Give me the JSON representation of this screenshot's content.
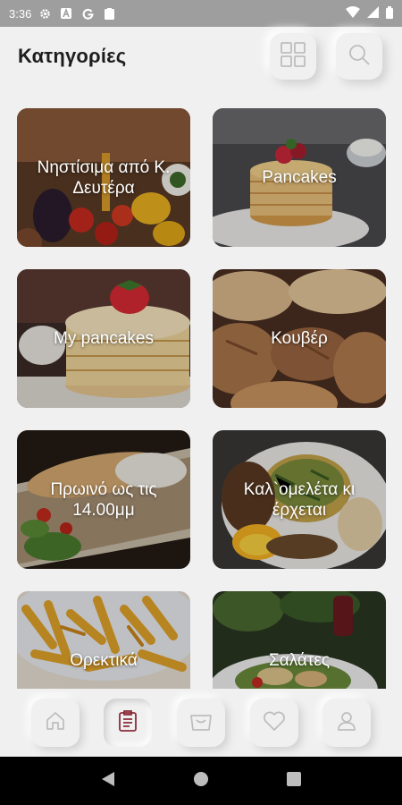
{
  "status_bar": {
    "time": "3:36",
    "left_icons": [
      "gear-icon",
      "a-badge-icon",
      "g-icon",
      "clipboard-icon"
    ],
    "right_icons": [
      "wifi-icon",
      "signal-icon",
      "battery-icon"
    ]
  },
  "header": {
    "title": "Κατηγορίες",
    "grid_icon": "grid-icon",
    "search_icon": "search-icon"
  },
  "categories": [
    {
      "label": "Νηστίσιμα από Κ. Δευτέρα",
      "image": "vegetables"
    },
    {
      "label": "Pancakes",
      "image": "pancakes"
    },
    {
      "label": "My pancakes",
      "image": "strawberry-pancakes"
    },
    {
      "label": "Κουβέρ",
      "image": "bread"
    },
    {
      "label": "Πρωινό ως τις 14.00μμ",
      "image": "sandwich"
    },
    {
      "label": "Καλ`ομελέτα κι έρχεται",
      "image": "omelette"
    },
    {
      "label": "Ορεκτικά",
      "image": "fries"
    },
    {
      "label": "Σαλάτες",
      "image": "salad"
    }
  ],
  "bottom_nav": [
    {
      "icon": "home-icon",
      "active": false
    },
    {
      "icon": "menu-list-icon",
      "active": true
    },
    {
      "icon": "basket-icon",
      "active": false
    },
    {
      "icon": "heart-icon",
      "active": false
    },
    {
      "icon": "user-icon",
      "active": false
    }
  ],
  "colors": {
    "background": "#f0f0f0",
    "accent": "#8b2c3a",
    "icon_gray": "#b8b8b8",
    "status_bar": "#9e9e9e"
  }
}
